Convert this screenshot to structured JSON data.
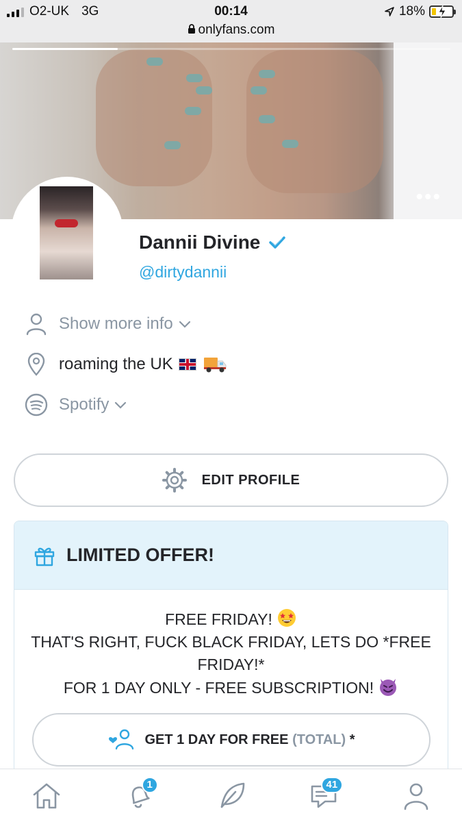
{
  "status_bar": {
    "carrier": "O2-UK",
    "network": "3G",
    "time": "00:14",
    "url": "onlyfans.com",
    "battery": "18%"
  },
  "profile": {
    "name": "Dannii Divine",
    "username": "@dirtydannii",
    "verified": true,
    "show_more": "Show more info",
    "location": "roaming the UK",
    "spotify": "Spotify"
  },
  "actions": {
    "edit_profile": "EDIT PROFILE"
  },
  "offer": {
    "title": "LIMITED OFFER!",
    "line1": "FREE FRIDAY!",
    "line2": "THAT'S RIGHT, FUCK BLACK FRIDAY, LETS DO *FREE FRIDAY!*",
    "line3": "FOR 1 DAY ONLY - FREE SUBSCRIPTION!",
    "button_main": "GET 1 DAY FOR FREE",
    "button_total": "(TOTAL)",
    "button_star": "*"
  },
  "nav": {
    "notifications_count": "1",
    "messages_count": "41"
  },
  "colors": {
    "accent": "#2fa6e0",
    "muted_text": "#8a96a3",
    "offer_header_bg": "#e3f3fb"
  }
}
